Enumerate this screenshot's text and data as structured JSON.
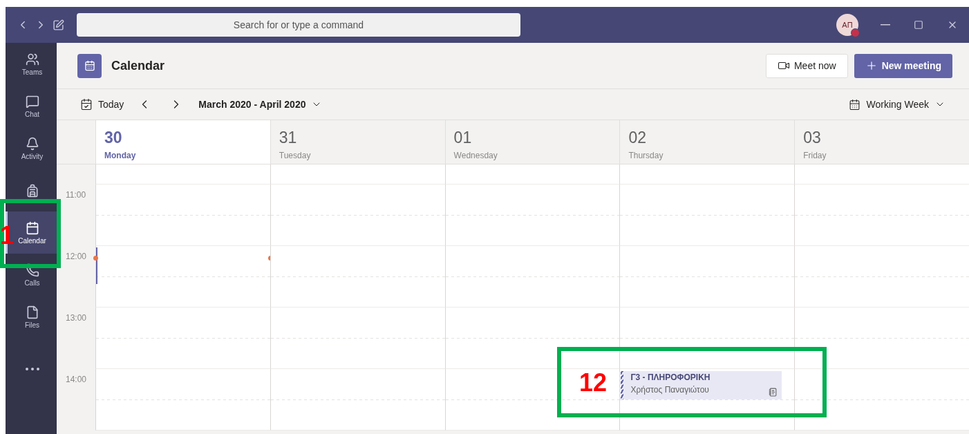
{
  "title_bar": {
    "search": {
      "placeholder": "Search for or type a command"
    },
    "avatar": {
      "initials": "ΑΠ"
    }
  },
  "sidebar": {
    "items": [
      {
        "kind": "teams",
        "label": "Teams",
        "selected": false
      },
      {
        "kind": "chat",
        "label": "Chat",
        "selected": false
      },
      {
        "kind": "activity",
        "label": "Activity",
        "selected": false
      },
      {
        "kind": "assignments",
        "selected": false
      },
      {
        "kind": "calendar",
        "label": "Calendar",
        "selected": true
      },
      {
        "kind": "calls",
        "label": "Calls",
        "selected": false
      },
      {
        "kind": "files",
        "label": "Files",
        "selected": false
      },
      {
        "kind": "more",
        "selected": false
      }
    ]
  },
  "header": {
    "title": "Calendar",
    "meet_now": "Meet now",
    "new_meeting": "New meeting"
  },
  "toolbar": {
    "today": "Today",
    "range": "March 2020 - April 2020",
    "view": "Working Week"
  },
  "days": [
    {
      "date": "30",
      "weekday": "Monday",
      "selected": true
    },
    {
      "date": "31",
      "weekday": "Tuesday",
      "selected": false
    },
    {
      "date": "01",
      "weekday": "Wednesday",
      "selected": false
    },
    {
      "date": "02",
      "weekday": "Thursday",
      "selected": false
    },
    {
      "date": "03",
      "weekday": "Friday",
      "selected": false
    }
  ],
  "hours": [
    {
      "label": "11:00",
      "cells": [
        {},
        {},
        {},
        {},
        {}
      ]
    },
    {
      "label": "12:00",
      "cells": [
        {
          "current_time": true
        },
        {},
        {},
        {},
        {}
      ]
    },
    {
      "label": "13:00",
      "cells": [
        {},
        {},
        {},
        {},
        {}
      ]
    },
    {
      "label": "14:00",
      "cells": [
        {},
        {},
        {},
        {
          "events": [
            {
              "title": "Γ3 - ΠΛΗΡΟΦΟΡΙΚΗ",
              "organizer": "Χρήστος Παναγιώτου"
            }
          ]
        },
        {}
      ]
    }
  ],
  "annotations": [
    {
      "label": "1"
    },
    {
      "label": "12"
    }
  ]
}
